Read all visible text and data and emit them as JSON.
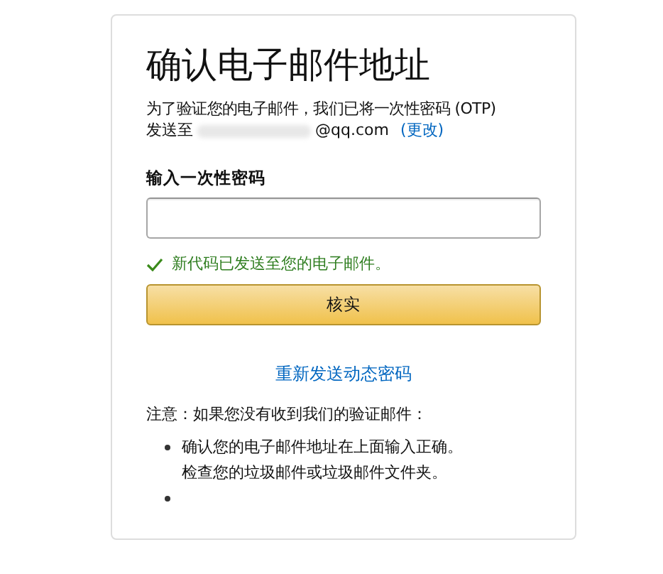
{
  "title": "确认电子邮件地址",
  "intro": {
    "text": "为了验证您的电子邮件，我们已将一次性密码 (OTP)",
    "sent_to_label": "发送至",
    "email_redacted": true,
    "email_visible": "@qq.com",
    "change_link": "(更改)"
  },
  "otp_field": {
    "label": "输入一次性密码"
  },
  "success_message": {
    "text": "新代码已发送至您的电子邮件。",
    "checked": true
  },
  "verify_button": "核实",
  "resend_link": "重新发送动态密码",
  "note": {
    "heading": "注意：如果您没有收到我们的验证邮件：",
    "bullets": [
      {
        "lines": [
          "确认您的电子邮件地址在上面输入正确。",
          "检查您的垃圾邮件或垃圾邮件文件夹。"
        ]
      }
    ],
    "trailing_empty_bullet": true
  }
}
